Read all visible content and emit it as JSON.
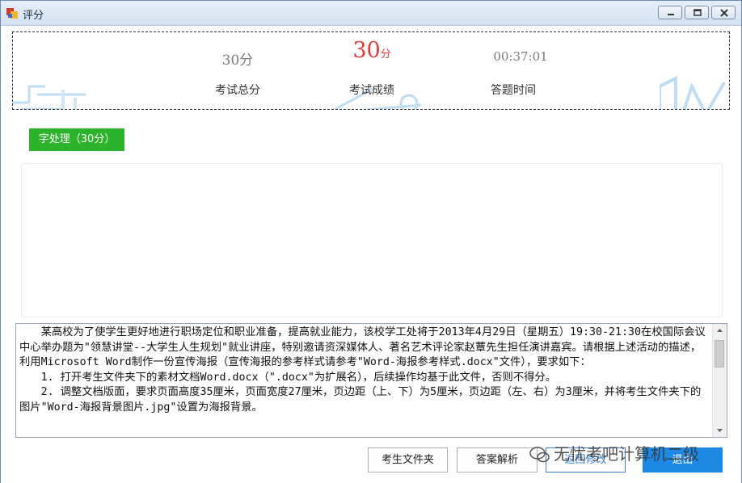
{
  "window": {
    "title": "评分"
  },
  "scores": {
    "total_value": "30分",
    "total_label": "考试总分",
    "result_number": "30",
    "result_unit": "分",
    "result_label": "考试成绩",
    "time_value": "00:37:01",
    "time_label": "答题时间"
  },
  "section": {
    "tag_label": "字处理（30分）"
  },
  "question": {
    "paragraphs": [
      "某高校为了使学生更好地进行职场定位和职业准备，提高就业能力，该校学工处将于2013年4月29日（星期五）19:30-21:30在校国际会议中心举办题为\"领慧讲堂--大学生人生规划\"就业讲座，特别邀请资深媒体人、著名艺术评论家赵蕈先生担任演讲嘉宾。请根据上述活动的描述，利用Microsoft Word制作一份宣传海报（宣传海报的参考样式请参考\"Word-海报参考样式.docx\"文件），要求如下：",
      "1. 打开考生文件夹下的素材文档Word.docx（\".docx\"为扩展名），后续操作均基于此文件，否则不得分。",
      "2. 调整文档版面，要求页面高度35厘米，页面宽度27厘米，页边距（上、下）为5厘米，页边距（左、右）为3厘米，并将考生文件夹下的图片\"Word-海报背景图片.jpg\"设置为海报背景。"
    ]
  },
  "buttons": {
    "student_folder": "考生文件夹",
    "answer_analysis": "答案解析",
    "back_to_review": "返回修改",
    "quit": "退出"
  },
  "watermark": {
    "text": "无忧考吧计算机二级"
  },
  "colors": {
    "score_red": "#e23c3c",
    "tag_green": "#2bb32b",
    "quit_blue": "#1e88e5"
  }
}
